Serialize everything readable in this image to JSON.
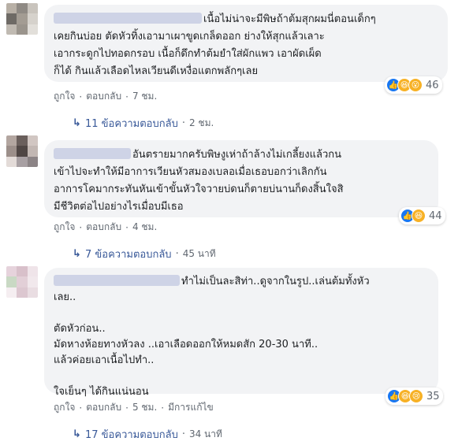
{
  "comments": [
    {
      "lines": [
        "เนื้อไม่น่าจะมีพิษถ้าต้มสุกผมนี่ตอนเด็กๆ",
        "เคยกินบ่อย ตัดหัวทิ้งเอามาเผาขูดเกล็ดออก ย่างให้สุกแล้วเลาะ",
        "เอากระดูกไปทอดกรอบ เนื้อก็ดึกทำต้มยำใส่ผักแพว เอาผัดเผ็ด",
        "ก็ได้ กินแล้วเลือดไหลเวียนดีเหงื่อแตกพลักๆเลย"
      ],
      "reactions": [
        "like-icon",
        "haha-icon",
        "wow-icon"
      ],
      "reaction_count": "46",
      "like_label": "ถูกใจ",
      "reply_label": "ตอบกลับ",
      "time": "7 ชม.",
      "edited_label": "",
      "replies_label": "11 ข้อความตอบกลับ",
      "replies_time": "2 ชม."
    },
    {
      "lines": [
        "อันตรายมากครับพิษงูเห่าถ้าล้างไม่เกลี้ยงแล้วกน",
        "เข้าไปจะทำให้มีอาการเวียนหัวสมองเบลอเมื่อเธอบอกว่าเลิกกัน",
        "อาการโคมากระทันหันเข้าขั้นหัวใจวายบ่ดนก็ตายบ่นานก็ดงสิ้นใจสิ",
        "มีชีวิตต่อไปอย่างไรเมื่อบมีเธอ"
      ],
      "reactions": [
        "like-icon",
        "haha-icon"
      ],
      "reaction_count": "44",
      "like_label": "ถูกใจ",
      "reply_label": "ตอบกลับ",
      "time": "4 ชม.",
      "edited_label": "",
      "replies_label": "7 ข้อความตอบกลับ",
      "replies_time": "45 นาที"
    },
    {
      "lines": [
        "ทำไม่เป็นละสิท่า..ดูจากในรูป..เล่นต้มทั้งหัว",
        "เลย..",
        "",
        "ตัดหัวก่อน..",
        "มัดหางห้อยทางหัวลง ..เอาเลือดออกให้หมดสัก 20-30 นาที..",
        "แล้วค่อยเอาเนื้อไปทำ..",
        "",
        "ใจเย็นๆ ได้กินแน่นอน"
      ],
      "reactions": [
        "like-icon",
        "haha-icon",
        "sad-icon"
      ],
      "reaction_count": "35",
      "like_label": "ถูกใจ",
      "reply_label": "ตอบกลับ",
      "time": "5 ชม.",
      "edited_label": "มีการแก้ไข",
      "replies_label": "17 ข้อความตอบกลับ",
      "replies_time": "34 นาที"
    }
  ],
  "separator": "·",
  "reply_arrow": "↳",
  "colors": {
    "bubble": "#f2f3f5",
    "link": "#385898",
    "meta": "#606770",
    "like": "#1877f2",
    "emoji": "#f7b125"
  }
}
